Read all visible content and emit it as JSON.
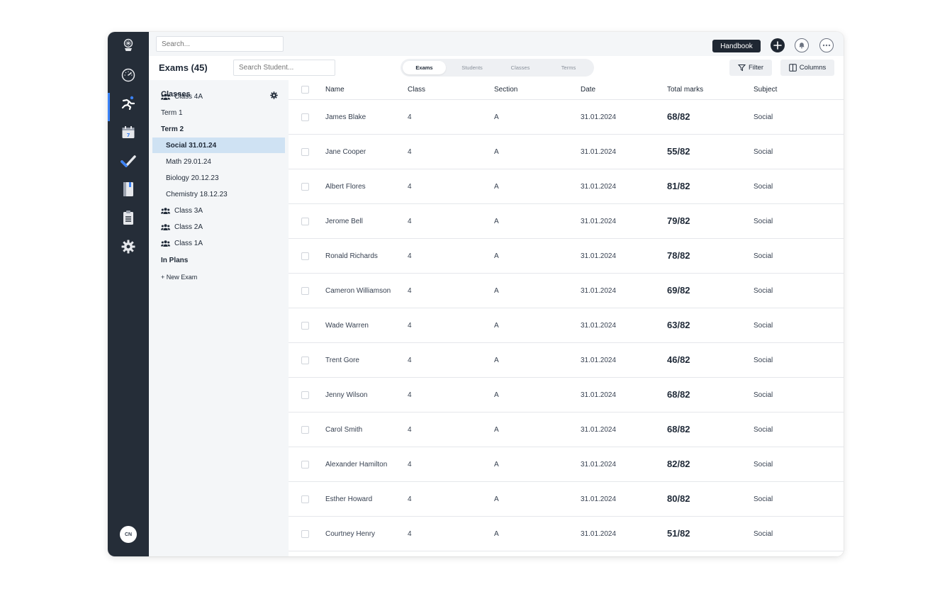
{
  "topbar": {
    "search_placeholder": "Search...",
    "handbook_label": "Handbook"
  },
  "rail": {
    "items": [
      {
        "name": "logo-icon"
      },
      {
        "name": "dashboard-gauge-icon"
      },
      {
        "name": "running-person-icon",
        "active": true
      },
      {
        "name": "calendar-icon"
      },
      {
        "name": "checkmark-icon"
      },
      {
        "name": "book-icon"
      },
      {
        "name": "clipboard-icon"
      },
      {
        "name": "gear-icon"
      }
    ],
    "avatar_initials": "CN"
  },
  "header": {
    "title": "Exams (45)",
    "student_search_placeholder": "Search Student...",
    "tabs": [
      {
        "label": "Exams",
        "active": true
      },
      {
        "label": "Students"
      },
      {
        "label": "Classes"
      },
      {
        "label": "Terms"
      }
    ],
    "filter_label": "Filter",
    "columns_label": "Columns"
  },
  "panel": {
    "title": "Classes",
    "items": [
      {
        "label": "Class 4A",
        "icon": "users-icon",
        "level": 0,
        "bold": false
      },
      {
        "label": "Term 1",
        "level": 0
      },
      {
        "label": "Term 2",
        "level": 0,
        "bold": true
      },
      {
        "label": "Social 31.01.24",
        "level": 1,
        "selected": true
      },
      {
        "label": "Math 29.01.24",
        "level": 1
      },
      {
        "label": "Biology 20.12.23",
        "level": 1
      },
      {
        "label": "Chemistry 18.12.23",
        "level": 1
      },
      {
        "label": "Class 3A",
        "icon": "users-icon",
        "level": 0
      },
      {
        "label": "Class 2A",
        "icon": "users-icon",
        "level": 0
      },
      {
        "label": "Class 1A",
        "icon": "users-icon",
        "level": 0
      },
      {
        "label": "In Plans",
        "level": 0,
        "bold": true
      },
      {
        "label": "+ New Exam",
        "level": 0,
        "small": true
      }
    ]
  },
  "table": {
    "columns": [
      "Name",
      "Class",
      "Section",
      "Date",
      "Total marks",
      "Subject"
    ],
    "rows": [
      {
        "name": "James Blake",
        "class": "4",
        "section": "A",
        "date": "31.01.2024",
        "marks": "68/82",
        "subject": "Social"
      },
      {
        "name": "Jane Cooper",
        "class": "4",
        "section": "A",
        "date": "31.01.2024",
        "marks": "55/82",
        "subject": "Social"
      },
      {
        "name": "Albert Flores",
        "class": "4",
        "section": "A",
        "date": "31.01.2024",
        "marks": "81/82",
        "subject": "Social"
      },
      {
        "name": "Jerome Bell",
        "class": "4",
        "section": "A",
        "date": "31.01.2024",
        "marks": "79/82",
        "subject": "Social"
      },
      {
        "name": "Ronald Richards",
        "class": "4",
        "section": "A",
        "date": "31.01.2024",
        "marks": "78/82",
        "subject": "Social"
      },
      {
        "name": "Cameron Williamson",
        "class": "4",
        "section": "A",
        "date": "31.01.2024",
        "marks": "69/82",
        "subject": "Social"
      },
      {
        "name": "Wade Warren",
        "class": "4",
        "section": "A",
        "date": "31.01.2024",
        "marks": "63/82",
        "subject": "Social"
      },
      {
        "name": "Trent Gore",
        "class": "4",
        "section": "A",
        "date": "31.01.2024",
        "marks": "46/82",
        "subject": "Social"
      },
      {
        "name": "Jenny Wilson",
        "class": "4",
        "section": "A",
        "date": "31.01.2024",
        "marks": "68/82",
        "subject": "Social"
      },
      {
        "name": "Carol Smith",
        "class": "4",
        "section": "A",
        "date": "31.01.2024",
        "marks": "68/82",
        "subject": "Social"
      },
      {
        "name": "Alexander Hamilton",
        "class": "4",
        "section": "A",
        "date": "31.01.2024",
        "marks": "82/82",
        "subject": "Social"
      },
      {
        "name": "Esther Howard",
        "class": "4",
        "section": "A",
        "date": "31.01.2024",
        "marks": "80/82",
        "subject": "Social"
      },
      {
        "name": "Courtney Henry",
        "class": "4",
        "section": "A",
        "date": "31.01.2024",
        "marks": "51/82",
        "subject": "Social"
      }
    ]
  },
  "colors": {
    "rail_bg": "#252d38",
    "accent": "#3b82f6",
    "selected_bg": "#cfe2f3",
    "panel_bg": "#f4f6f8"
  }
}
